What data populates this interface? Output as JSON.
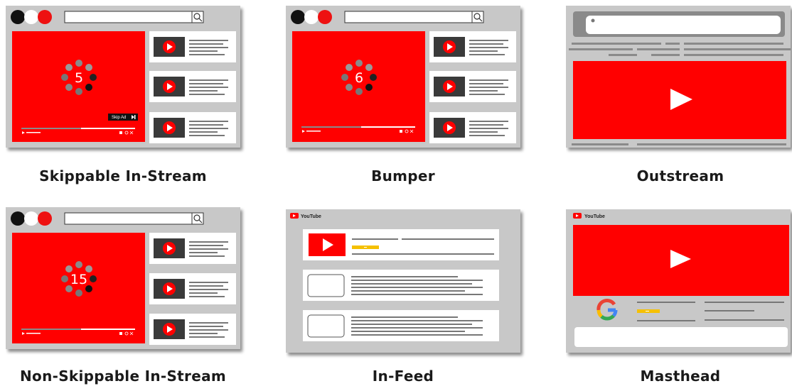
{
  "ads": [
    {
      "id": "skippable",
      "caption": "Skippable In-Stream",
      "counter": "5",
      "skip_label": "Skip Ad"
    },
    {
      "id": "bumper",
      "caption": "Bumper",
      "counter": "6"
    },
    {
      "id": "outstream",
      "caption": "Outstream"
    },
    {
      "id": "nonskippable",
      "caption": "Non-Skippable In-Stream",
      "counter": "15"
    },
    {
      "id": "infeed",
      "caption": "In-Feed",
      "brand": "YouTube"
    },
    {
      "id": "masthead",
      "caption": "Masthead",
      "brand": "YouTube"
    }
  ],
  "colors": {
    "red": "#ff0000",
    "frame": "#c8c8c8",
    "dark": "#333333",
    "yellow": "#f5c000"
  },
  "icons": [
    "search-icon",
    "play-icon",
    "skip-icon",
    "loading-spinner-icon",
    "google-logo-icon",
    "youtube-logo-icon"
  ]
}
